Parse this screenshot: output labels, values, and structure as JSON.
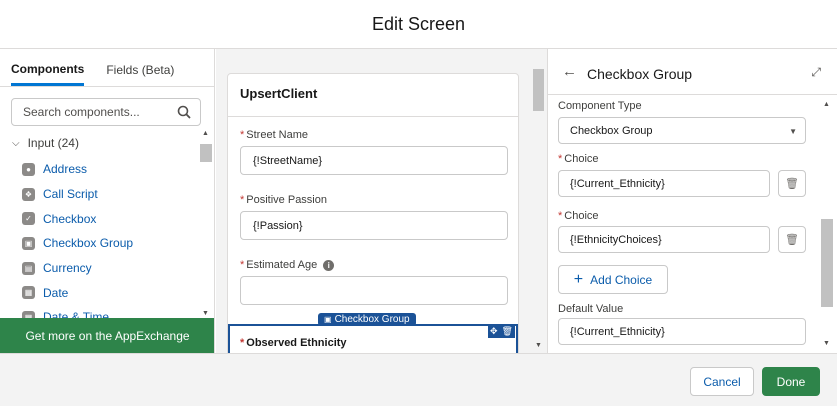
{
  "header": {
    "title": "Edit Screen"
  },
  "left_panel": {
    "tabs": [
      {
        "label": "Components",
        "active": true
      },
      {
        "label": "Fields (Beta)",
        "active": false
      }
    ],
    "search": {
      "placeholder": "Search components..."
    },
    "section": {
      "label": "Input (24)"
    },
    "components": [
      {
        "label": "Address",
        "icon": "address-pin-icon"
      },
      {
        "label": "Call Script",
        "icon": "call-script-bolt-icon"
      },
      {
        "label": "Checkbox",
        "icon": "checkbox-icon"
      },
      {
        "label": "Checkbox Group",
        "icon": "checkbox-group-icon"
      },
      {
        "label": "Currency",
        "icon": "currency-icon"
      },
      {
        "label": "Date",
        "icon": "date-icon"
      },
      {
        "label": "Date & Time",
        "icon": "date-time-icon"
      }
    ],
    "appexchange_label": "Get more on the AppExchange"
  },
  "canvas": {
    "screen_title": "UpsertClient",
    "fields": [
      {
        "label": "Street Name",
        "value": "{!StreetName}",
        "required": true
      },
      {
        "label": "Positive Passion",
        "value": "{!Passion}",
        "required": true
      },
      {
        "label": "Estimated Age",
        "value": "",
        "required": true,
        "has_info": true
      }
    ],
    "selected_component": {
      "tag": "Checkbox Group",
      "label": "Observed Ethnicity",
      "required": true
    }
  },
  "properties": {
    "title": "Checkbox Group",
    "component_type_label": "Component Type",
    "component_type_value": "Checkbox Group",
    "choices": [
      {
        "label": "Choice",
        "value": "{!Current_Ethnicity}"
      },
      {
        "label": "Choice",
        "value": "{!EthnicityChoices}"
      }
    ],
    "add_choice_label": "Add Choice",
    "default_value_label": "Default Value",
    "default_value": "{!Current_Ethnicity}"
  },
  "footer": {
    "cancel_label": "Cancel",
    "done_label": "Done"
  },
  "colors": {
    "brand_blue": "#0176d3",
    "link_blue": "#0b5cab",
    "success_green": "#2e844a",
    "selection_blue": "#1b5297",
    "required_red": "#c23934"
  }
}
